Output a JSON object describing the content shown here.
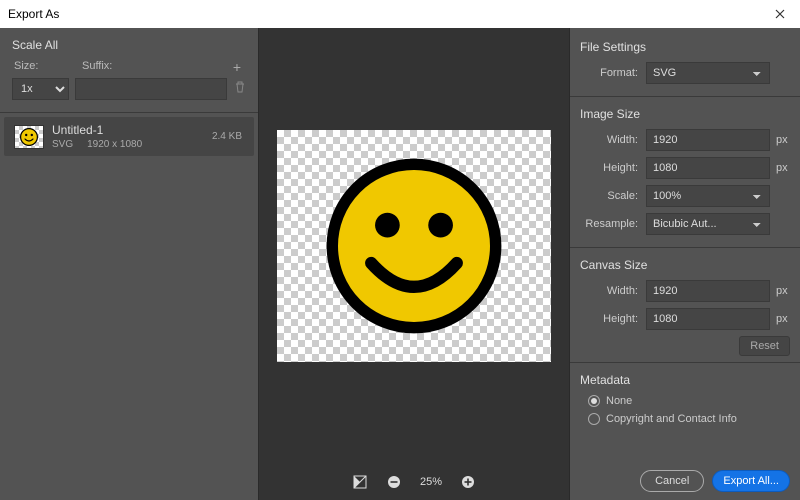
{
  "window": {
    "title": "Export As"
  },
  "scaleAll": {
    "heading": "Scale All",
    "sizeLabel": "Size:",
    "suffixLabel": "Suffix:",
    "sizeValue": "1x",
    "suffixValue": ""
  },
  "asset": {
    "name": "Untitled-1",
    "format": "SVG",
    "dims": "1920 x 1080",
    "filesize": "2.4 KB"
  },
  "zoom": {
    "level": "25%"
  },
  "fileSettings": {
    "heading": "File Settings",
    "formatLabel": "Format:",
    "formatValue": "SVG"
  },
  "imageSize": {
    "heading": "Image Size",
    "widthLabel": "Width:",
    "heightLabel": "Height:",
    "scaleLabel": "Scale:",
    "resampleLabel": "Resample:",
    "width": "1920",
    "height": "1080",
    "scale": "100%",
    "resample": "Bicubic Aut...",
    "px": "px"
  },
  "canvasSize": {
    "heading": "Canvas Size",
    "widthLabel": "Width:",
    "heightLabel": "Height:",
    "width": "1920",
    "height": "1080",
    "px": "px",
    "reset": "Reset"
  },
  "metadata": {
    "heading": "Metadata",
    "none": "None",
    "copyright": "Copyright and Contact Info"
  },
  "buttons": {
    "cancel": "Cancel",
    "export": "Export All..."
  }
}
